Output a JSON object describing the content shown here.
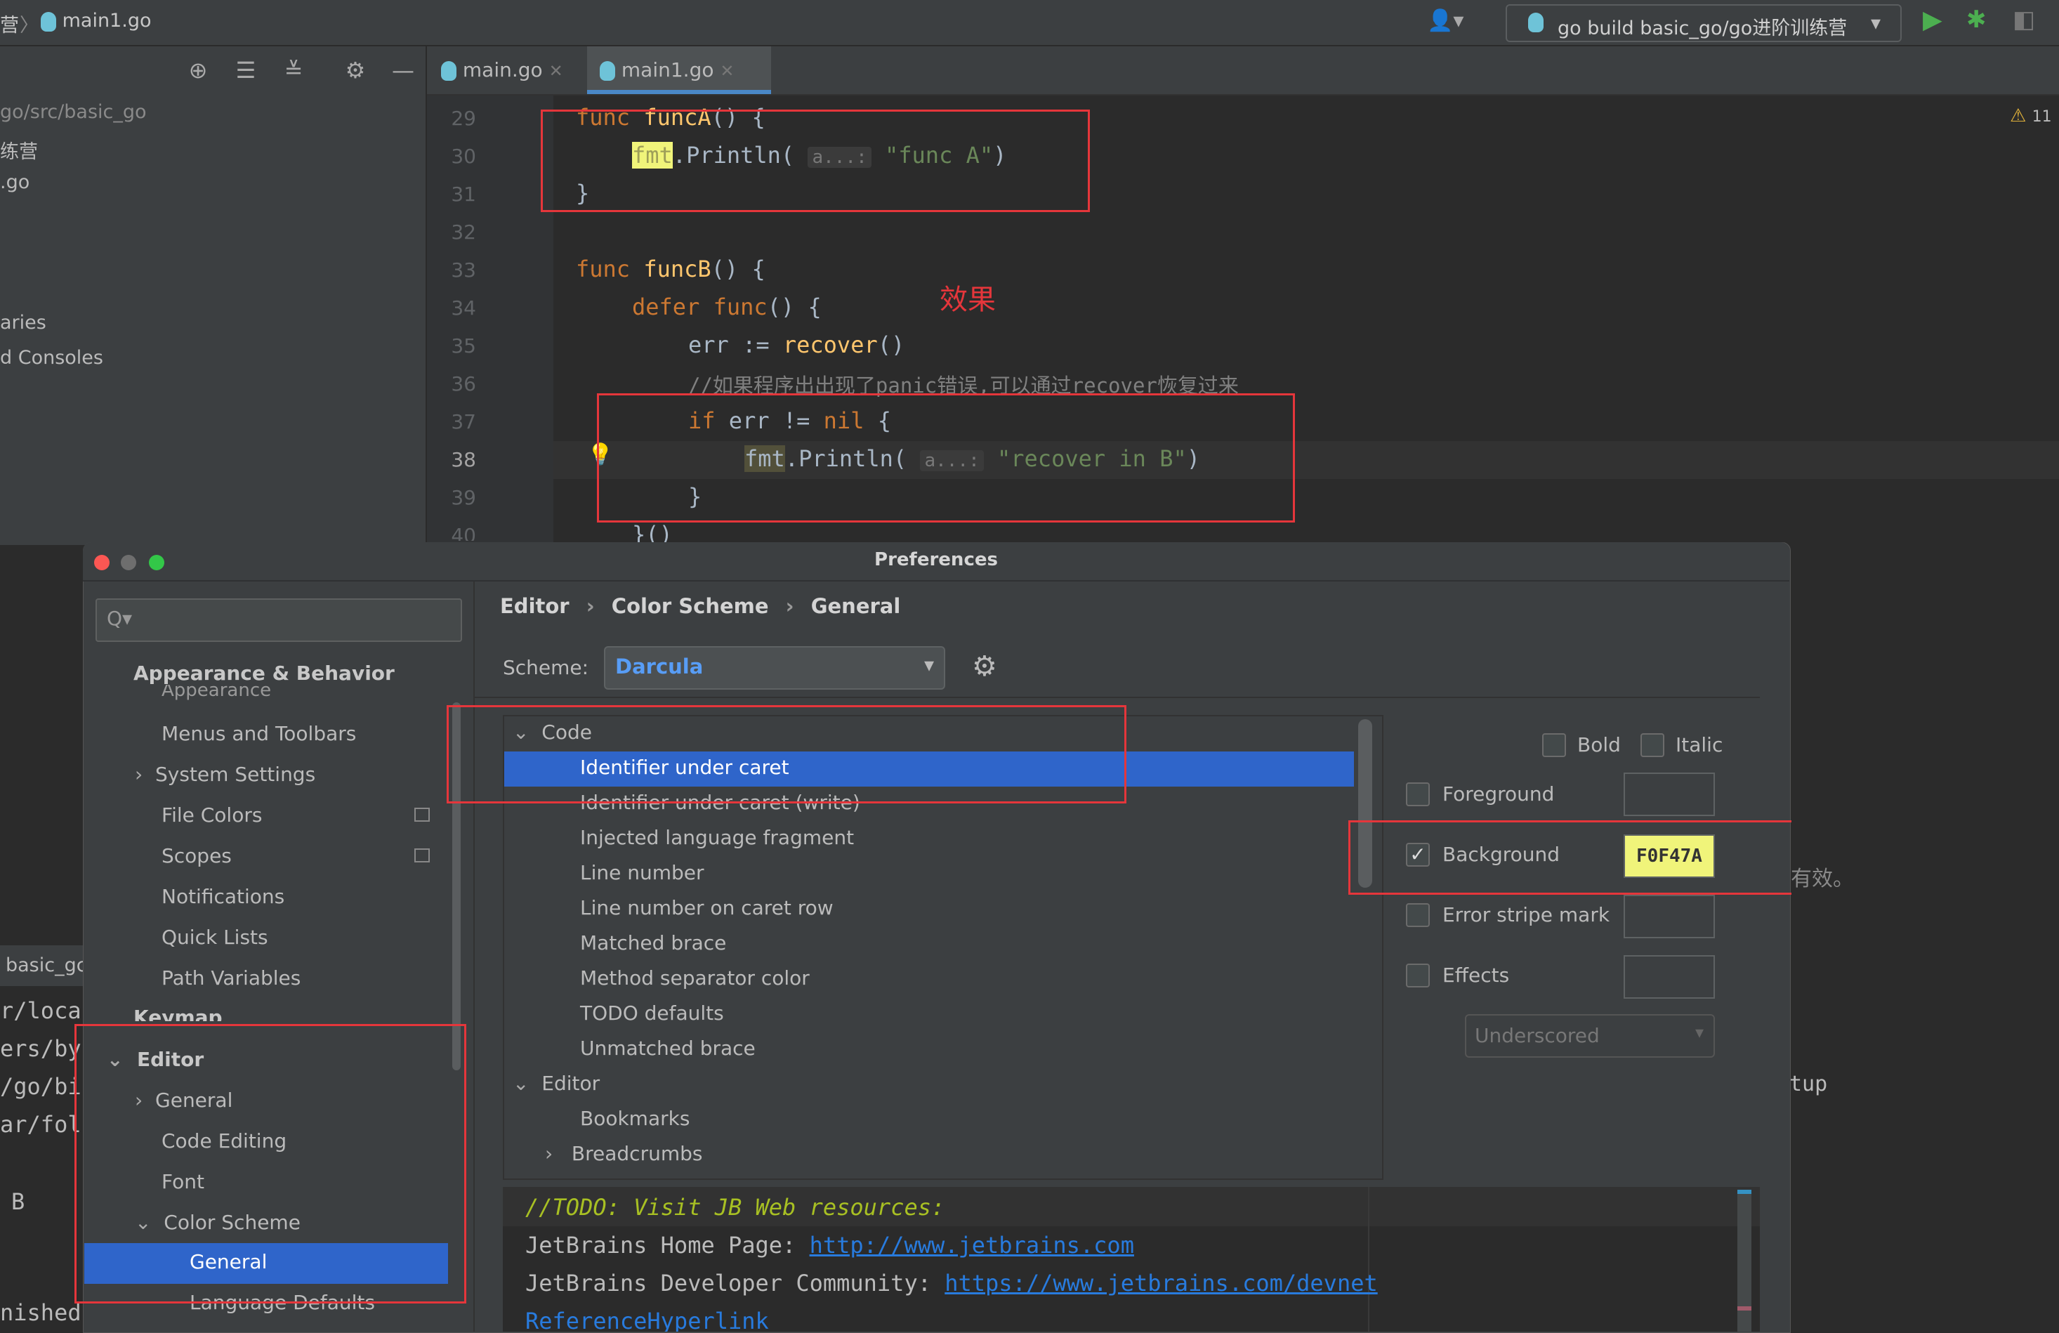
{
  "titlebar": {
    "crumb_left": "营",
    "file": "main1.go",
    "run_config": "go build basic_go/go进阶训练营"
  },
  "project": {
    "path": "go/src/basic_go",
    "items": [
      "练营",
      ".go",
      "aries",
      "d Consoles"
    ]
  },
  "tabs": [
    {
      "label": "main.go",
      "active": false
    },
    {
      "label": "main1.go",
      "active": true
    }
  ],
  "editor": {
    "warning_count": "11",
    "annotation": "效果",
    "line_numbers": [
      "29",
      "30",
      "31",
      "32",
      "33",
      "34",
      "35",
      "36",
      "37",
      "38",
      "39",
      "40"
    ],
    "hint": "a...:",
    "comment": "//如果程序出出现了panic错误,可以通过recover恢复过来",
    "side_text": "有效。",
    "side_text2": "tup"
  },
  "run_panel": {
    "tab": "basic_gc",
    "lines": [
      "r/loca",
      "ers/by",
      "/go/bi",
      "ar/fol",
      "B",
      "nished"
    ]
  },
  "dialog": {
    "title": "Preferences",
    "search_placeholder": "Q▾",
    "breadcrumb": [
      "Editor",
      "Color Scheme",
      "General"
    ],
    "scheme_label": "Scheme:",
    "scheme_value": "Darcula",
    "nav": {
      "section1": "Appearance & Behavior",
      "appearance": "Appearance",
      "menus_toolbars": "Menus and Toolbars",
      "system_settings": "System Settings",
      "file_colors": "File Colors",
      "scopes": "Scopes",
      "notifications": "Notifications",
      "quick_lists": "Quick Lists",
      "path_variables": "Path Variables",
      "keymap": "Keymap",
      "editor": "Editor",
      "general": "General",
      "code_editing": "Code Editing",
      "font": "Font",
      "color_scheme": "Color Scheme",
      "cs_general": "General",
      "language_defaults": "Language Defaults"
    },
    "options": {
      "code": "Code",
      "items": [
        "Identifier under caret",
        "Identifier under caret (write)",
        "Injected language fragment",
        "Line number",
        "Line number on caret row",
        "Matched brace",
        "Method separator color",
        "TODO defaults",
        "Unmatched brace"
      ],
      "editor": "Editor",
      "editor_items": [
        "Bookmarks",
        "Breadcrumbs"
      ]
    },
    "attributes": {
      "bold": "Bold",
      "italic": "Italic",
      "foreground": "Foreground",
      "background": "Background",
      "background_value": "F0F47A",
      "error_stripe": "Error stripe mark",
      "effects": "Effects",
      "effect_type": "Underscored"
    },
    "preview": {
      "todo": "//TODO: Visit JB Web resources:",
      "home_label": "JetBrains Home Page: ",
      "home_url": "http://www.jetbrains.com",
      "dev_label": "JetBrains Developer Community: ",
      "dev_url": "https://www.jetbrains.com/devnet",
      "ref": "ReferenceHyperlink"
    }
  },
  "colors": {
    "accent": "#2f65ca",
    "highlight": "#F0F47A",
    "annotation_red": "#e5363b"
  }
}
